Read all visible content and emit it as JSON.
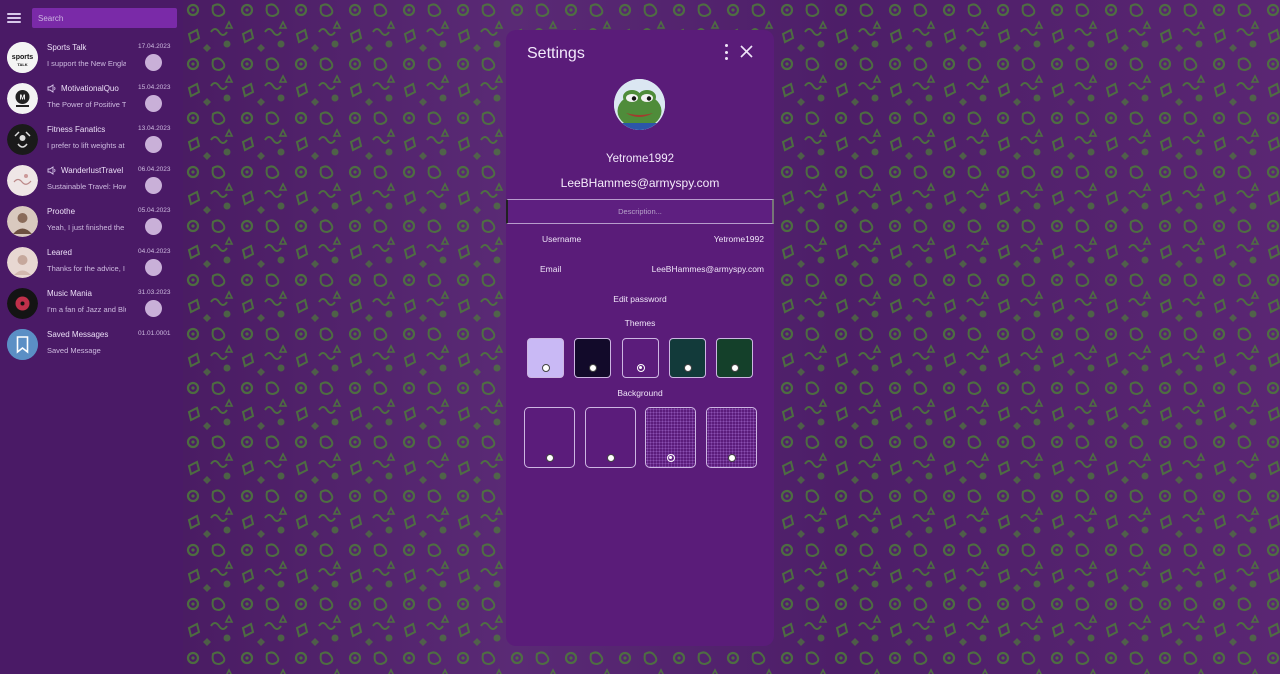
{
  "sidebar": {
    "search_placeholder": "Search",
    "chats": [
      {
        "name": "Sports Talk",
        "preview": "I support the New England Patriots",
        "date": "17.04.2023",
        "muted": false,
        "avatar_icon": "sports-talk-logo"
      },
      {
        "name": "MotivationalQuo",
        "preview": "The Power of Positive Thinking",
        "date": "15.04.2023",
        "muted": true,
        "avatar_icon": "motivational-logo"
      },
      {
        "name": "Fitness Fanatics",
        "preview": "I prefer to lift weights at home",
        "date": "13.04.2023",
        "muted": false,
        "avatar_icon": "fitness-logo"
      },
      {
        "name": "WanderlustTravel",
        "preview": "Sustainable Travel: How to",
        "date": "06.04.2023",
        "muted": true,
        "avatar_icon": "wanderlust-logo"
      },
      {
        "name": "Proothe",
        "preview": "Yeah, I just finished the book",
        "date": "05.04.2023",
        "muted": false,
        "avatar_icon": "user-photo"
      },
      {
        "name": "Leared",
        "preview": "Thanks for the advice, I will",
        "date": "04.04.2023",
        "muted": false,
        "avatar_icon": "user-photo"
      },
      {
        "name": "Music Mania",
        "preview": "I'm a fan of Jazz and Blues",
        "date": "31.03.2023",
        "muted": false,
        "avatar_icon": "music-logo"
      },
      {
        "name": "Saved Messages",
        "preview": "Saved Message",
        "date": "01.01.0001",
        "muted": false,
        "avatar_icon": "bookmark-icon"
      }
    ]
  },
  "settings": {
    "title": "Settings",
    "profile": {
      "username": "Yetrome1992",
      "email": "LeeBHammes@armyspy.com",
      "avatar_icon": "frog-avatar"
    },
    "description_placeholder": "Description...",
    "fields": {
      "username_label": "Username",
      "username_value": "Yetrome1992",
      "email_label": "Email",
      "email_value": "LeeBHammes@armyspy.com"
    },
    "edit_password": "Edit password",
    "themes_title": "Themes",
    "themes": [
      {
        "color": "#c9b9f5",
        "selected": false
      },
      {
        "color": "#120a2a",
        "selected": false
      },
      {
        "color": "#5b1c7b",
        "selected": true
      },
      {
        "color": "#123a3a",
        "selected": false
      },
      {
        "color": "#14402a",
        "selected": false
      }
    ],
    "background_title": "Background",
    "backgrounds": [
      {
        "style": "plain",
        "selected": false
      },
      {
        "style": "plain",
        "selected": false
      },
      {
        "style": "dotted",
        "selected": true
      },
      {
        "style": "dotted",
        "selected": false
      }
    ]
  },
  "colors": {
    "sidebar": "#4a1a66",
    "panel": "#5a1c79",
    "search": "#7a2aa8",
    "pattern": "#4d7a3a"
  }
}
